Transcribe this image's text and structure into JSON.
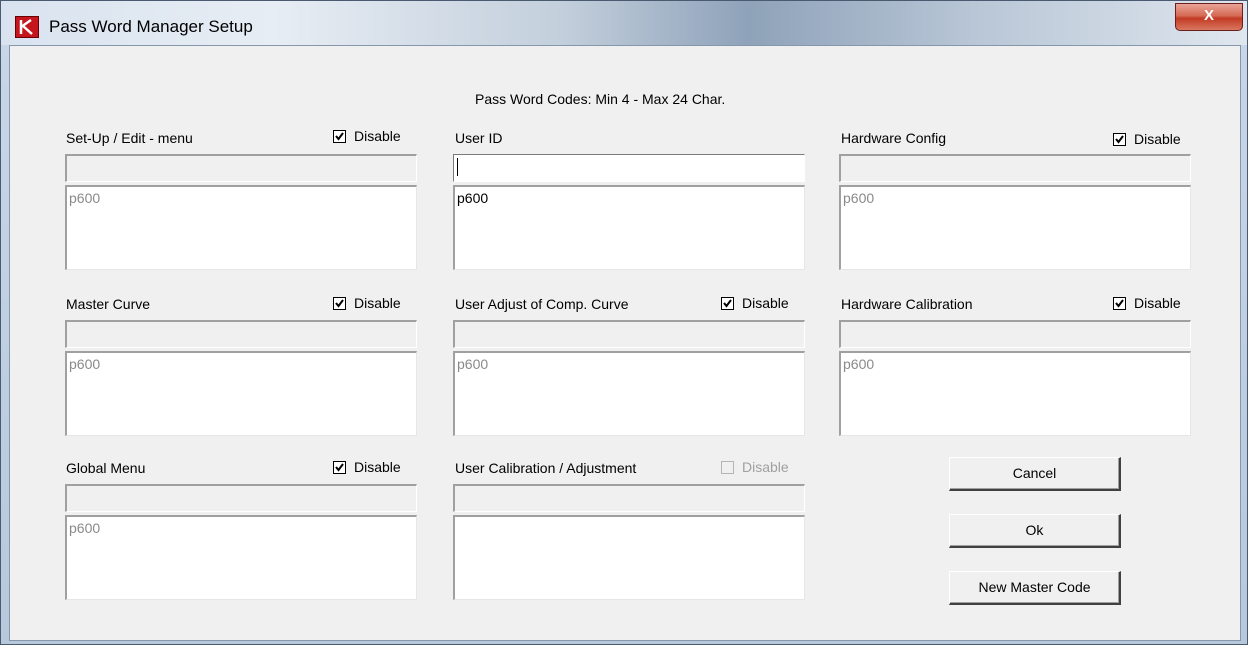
{
  "window": {
    "title": "Pass Word Manager Setup",
    "close_label": "X"
  },
  "header_note": "Pass Word Codes:  Min 4   - Max 24 Char.",
  "sections": {
    "setup_edit": {
      "label": "Set-Up / Edit - menu",
      "disable_label": "Disable",
      "disable_checked": true,
      "disable_enabled": true,
      "input_value": "",
      "list_text": "p600"
    },
    "user_id": {
      "label": "User ID",
      "input_value": "",
      "list_text": "p600"
    },
    "hardware_config": {
      "label": "Hardware Config",
      "disable_label": "Disable",
      "disable_checked": true,
      "disable_enabled": true,
      "input_value": "",
      "list_text": "p600"
    },
    "master_curve": {
      "label": "Master Curve",
      "disable_label": "Disable",
      "disable_checked": true,
      "disable_enabled": true,
      "input_value": "",
      "list_text": "p600"
    },
    "user_adjust": {
      "label": "User Adjust of Comp. Curve",
      "disable_label": "Disable",
      "disable_checked": true,
      "disable_enabled": true,
      "input_value": "",
      "list_text": "p600"
    },
    "hardware_calibration": {
      "label": "Hardware Calibration",
      "disable_label": "Disable",
      "disable_checked": true,
      "disable_enabled": true,
      "input_value": "",
      "list_text": "p600"
    },
    "global_menu": {
      "label": "Global Menu",
      "disable_label": "Disable",
      "disable_checked": true,
      "disable_enabled": true,
      "input_value": "",
      "list_text": "p600"
    },
    "user_calibration": {
      "label": "User Calibration / Adjustment",
      "disable_label": "Disable",
      "disable_checked": false,
      "disable_enabled": false,
      "input_value": "",
      "list_text": ""
    }
  },
  "buttons": {
    "cancel": "Cancel",
    "ok": "Ok",
    "new_master_code": "New Master Code"
  },
  "icons": {
    "app": "app-logo-icon",
    "close": "close-icon",
    "check": "checkmark-icon"
  }
}
